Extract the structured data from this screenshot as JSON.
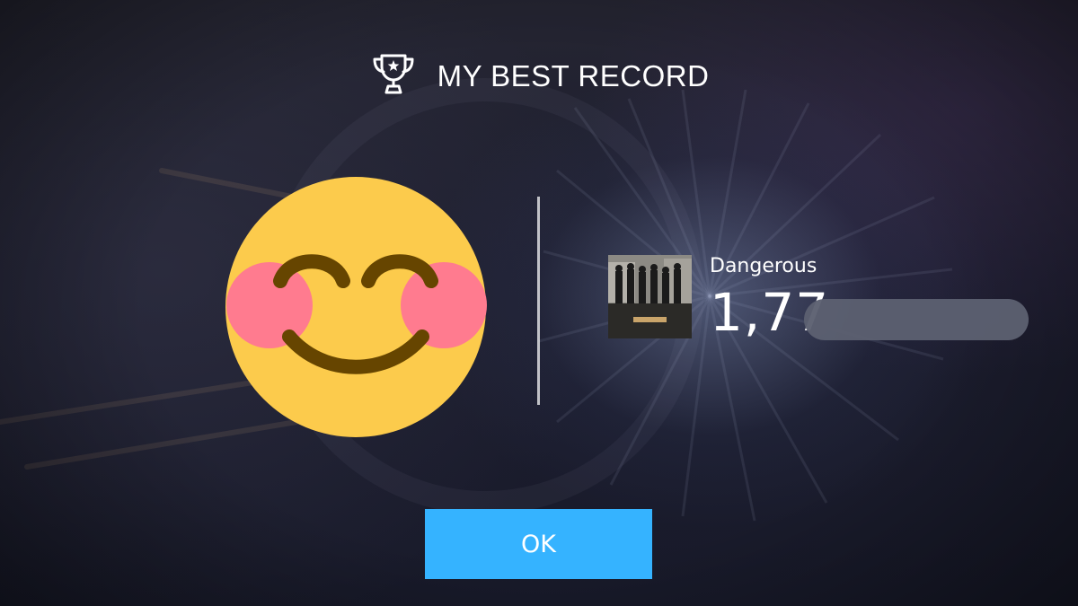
{
  "header": {
    "icon": "trophy-icon",
    "title": "MY BEST RECORD"
  },
  "emoji": {
    "icon": "smiling-face-with-blush-emoji",
    "face_color": "#FCCB4C",
    "cheek_color": "#FF7B8F",
    "feature_color": "#664500"
  },
  "record": {
    "album_art": "album-cover-grown",
    "song_title": "Dangerous",
    "score_visible": "1,77"
  },
  "ok_button": {
    "label": "OK",
    "color": "#35B3FF"
  },
  "colors": {
    "background": "#1C1D2E",
    "text": "#FFFFFF"
  }
}
